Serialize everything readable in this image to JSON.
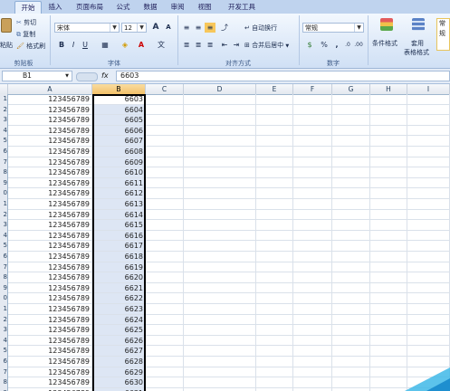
{
  "tabs": [
    "开始",
    "插入",
    "页面布局",
    "公式",
    "数据",
    "审阅",
    "视图",
    "开发工具"
  ],
  "ribbon": {
    "clipboard": {
      "paste": "粘贴",
      "cut": "剪切",
      "copy": "复制",
      "format_painter": "格式刷",
      "label": "剪贴板"
    },
    "font": {
      "font_name": "宋体",
      "font_size": "12",
      "label": "字体",
      "bold": "B",
      "italic": "I",
      "underline": "U",
      "grow": "A",
      "shrink": "A"
    },
    "alignment": {
      "wrap_text": "自动换行",
      "merge_center": "合并后居中",
      "label": "对齐方式"
    },
    "number": {
      "format": "常规",
      "label": "数字",
      "percent": "%",
      "comma": ","
    },
    "styles": {
      "conditional": "条件格式",
      "table_format_1": "套用",
      "table_format_2": "表格格式",
      "cell_style": "常规"
    }
  },
  "formula_bar": {
    "name_box": "B1",
    "fx": "fx",
    "value": "6603"
  },
  "columns": [
    "A",
    "B",
    "C",
    "D",
    "E",
    "F",
    "G",
    "H",
    "I"
  ],
  "selected_column": "B",
  "rows": [
    {
      "n": "1",
      "a": "123456789",
      "b": "6603"
    },
    {
      "n": "2",
      "a": "123456789",
      "b": "6604"
    },
    {
      "n": "3",
      "a": "123456789",
      "b": "6605"
    },
    {
      "n": "4",
      "a": "123456789",
      "b": "6606"
    },
    {
      "n": "5",
      "a": "123456789",
      "b": "6607"
    },
    {
      "n": "6",
      "a": "123456789",
      "b": "6608"
    },
    {
      "n": "7",
      "a": "123456789",
      "b": "6609"
    },
    {
      "n": "8",
      "a": "123456789",
      "b": "6610"
    },
    {
      "n": "9",
      "a": "123456789",
      "b": "6611"
    },
    {
      "n": "0",
      "a": "123456789",
      "b": "6612"
    },
    {
      "n": "1",
      "a": "123456789",
      "b": "6613"
    },
    {
      "n": "2",
      "a": "123456789",
      "b": "6614"
    },
    {
      "n": "3",
      "a": "123456789",
      "b": "6615"
    },
    {
      "n": "4",
      "a": "123456789",
      "b": "6616"
    },
    {
      "n": "5",
      "a": "123456789",
      "b": "6617"
    },
    {
      "n": "6",
      "a": "123456789",
      "b": "6618"
    },
    {
      "n": "7",
      "a": "123456789",
      "b": "6619"
    },
    {
      "n": "8",
      "a": "123456789",
      "b": "6620"
    },
    {
      "n": "9",
      "a": "123456789",
      "b": "6621"
    },
    {
      "n": "0",
      "a": "123456789",
      "b": "6622"
    },
    {
      "n": "1",
      "a": "123456789",
      "b": "6623"
    },
    {
      "n": "2",
      "a": "123456789",
      "b": "6624"
    },
    {
      "n": "3",
      "a": "123456789",
      "b": "6625"
    },
    {
      "n": "4",
      "a": "123456789",
      "b": "6626"
    },
    {
      "n": "5",
      "a": "123456789",
      "b": "6627"
    },
    {
      "n": "6",
      "a": "123456789",
      "b": "6628"
    },
    {
      "n": "7",
      "a": "123456789",
      "b": "6629"
    },
    {
      "n": "8",
      "a": "123456789",
      "b": "6630"
    },
    {
      "n": "9",
      "a": "123456789",
      "b": "6631"
    },
    {
      "n": "0",
      "a": "123456789",
      "b": "6632"
    }
  ],
  "icons": {
    "cut": "scissors-icon",
    "copy": "copy-icon",
    "painter": "paintbrush-icon",
    "bold": "bold-icon",
    "italic": "italic-icon",
    "underline": "underline-icon",
    "border": "border-icon",
    "fill": "fill-color-icon",
    "font_color": "font-color-icon",
    "align": "align-icon",
    "wrap": "wrap-text-icon",
    "merge": "merge-icon",
    "currency": "currency-icon",
    "cond": "conditional-format-icon",
    "table": "table-format-icon"
  },
  "colors": {
    "accent": "#f3c16a",
    "selection": "#dde6f4",
    "ribbon_tab": "#bfd3ee"
  }
}
